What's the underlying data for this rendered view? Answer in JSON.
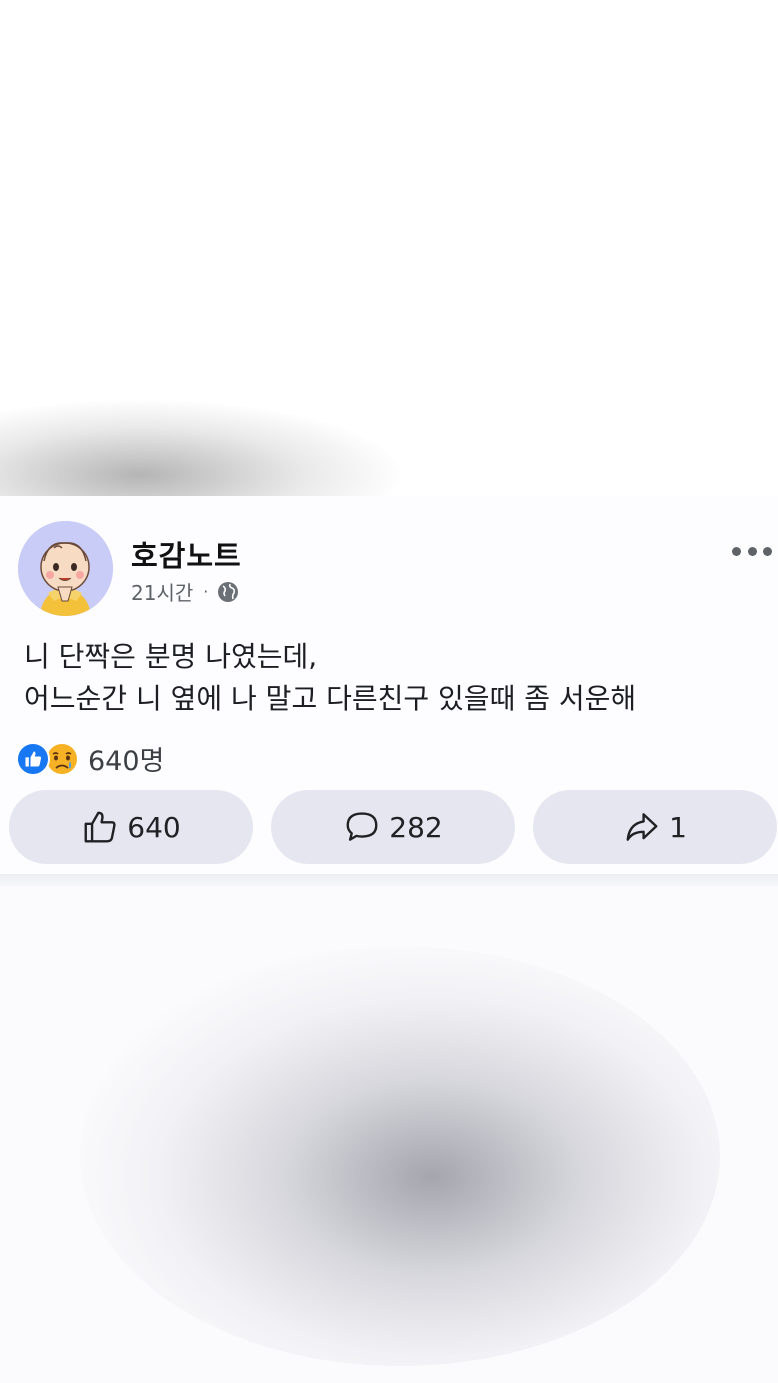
{
  "post": {
    "author": "호감노트",
    "time": "21시간",
    "separator": "·",
    "text_line1": "니 단짝은 분명 나였는데,",
    "text_line2": "어느순간 니 옆에 나 말고 다른친구 있을때 좀 서운해",
    "reaction_summary": "640명",
    "reaction_icons": [
      "like-icon",
      "sad-icon"
    ]
  },
  "actions": {
    "like_count": "640",
    "comment_count": "282",
    "share_count": "1"
  },
  "icons": {
    "more": "more-options-icon",
    "privacy": "globe-icon",
    "like": "thumbs-up-icon",
    "comment": "speech-bubble-icon",
    "share": "share-arrow-icon"
  },
  "colors": {
    "avatar_bg": "#c9ccf7",
    "like_blue": "#1877f2",
    "button_bg": "#e5e6f0"
  }
}
